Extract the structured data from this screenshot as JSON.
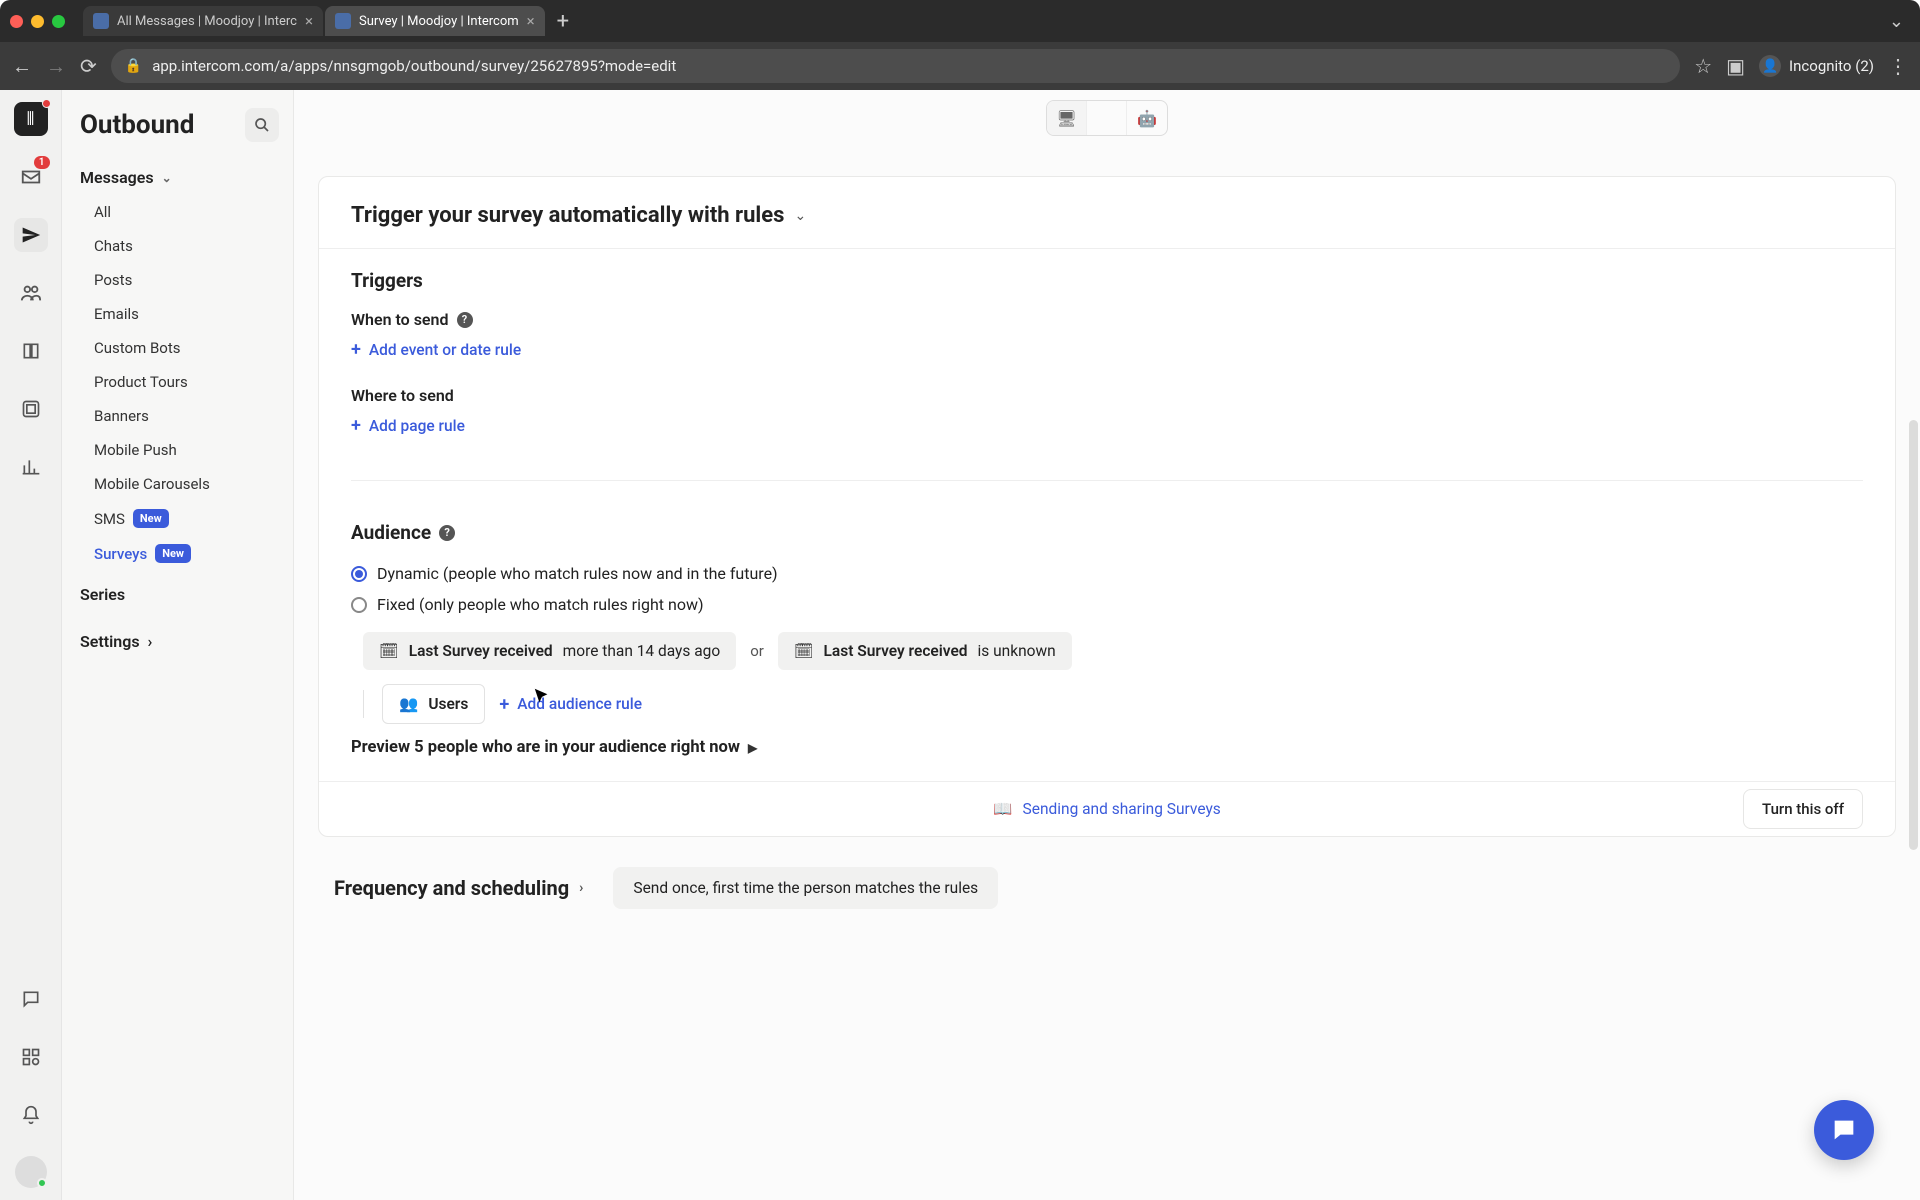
{
  "browser": {
    "tabs": [
      {
        "title": "All Messages | Moodjoy | Interc"
      },
      {
        "title": "Survey | Moodjoy | Intercom"
      }
    ],
    "url": "app.intercom.com/a/apps/nnsgmgob/outbound/survey/25627895?mode=edit",
    "incognito": "Incognito (2)"
  },
  "rail": {
    "inbox_badge": "1"
  },
  "sidebar": {
    "title": "Outbound",
    "group": {
      "label": "Messages"
    },
    "items": [
      {
        "label": "All"
      },
      {
        "label": "Chats"
      },
      {
        "label": "Posts"
      },
      {
        "label": "Emails"
      },
      {
        "label": "Custom Bots"
      },
      {
        "label": "Product Tours"
      },
      {
        "label": "Banners"
      },
      {
        "label": "Mobile Push"
      },
      {
        "label": "Mobile Carousels"
      },
      {
        "label": "SMS",
        "badge": "New"
      },
      {
        "label": "Surveys",
        "badge": "New",
        "active": true
      }
    ],
    "series": "Series",
    "settings": "Settings"
  },
  "trigger_card": {
    "heading": "Trigger your survey automatically with rules",
    "triggers_title": "Triggers",
    "when_to_send": "When to send",
    "add_event_rule": "Add event or date rule",
    "where_to_send": "Where to send",
    "add_page_rule": "Add page rule",
    "audience_title": "Audience",
    "dynamic_label": "Dynamic (people who match rules now and in the future)",
    "fixed_label": "Fixed (only people who match rules right now)",
    "chip1_bold": "Last Survey received",
    "chip1_rest": " more than 14 days ago",
    "chip_or": "or",
    "chip2_bold": "Last Survey received",
    "chip2_rest": " is unknown",
    "users_chip": "Users",
    "add_audience_rule": "Add audience rule",
    "preview": "Preview 5 people who are in your audience right now",
    "doc_link": "Sending and sharing Surveys",
    "turn_off": "Turn this off"
  },
  "frequency": {
    "title": "Frequency and scheduling",
    "pill": "Send once, first time the person matches the rules"
  }
}
